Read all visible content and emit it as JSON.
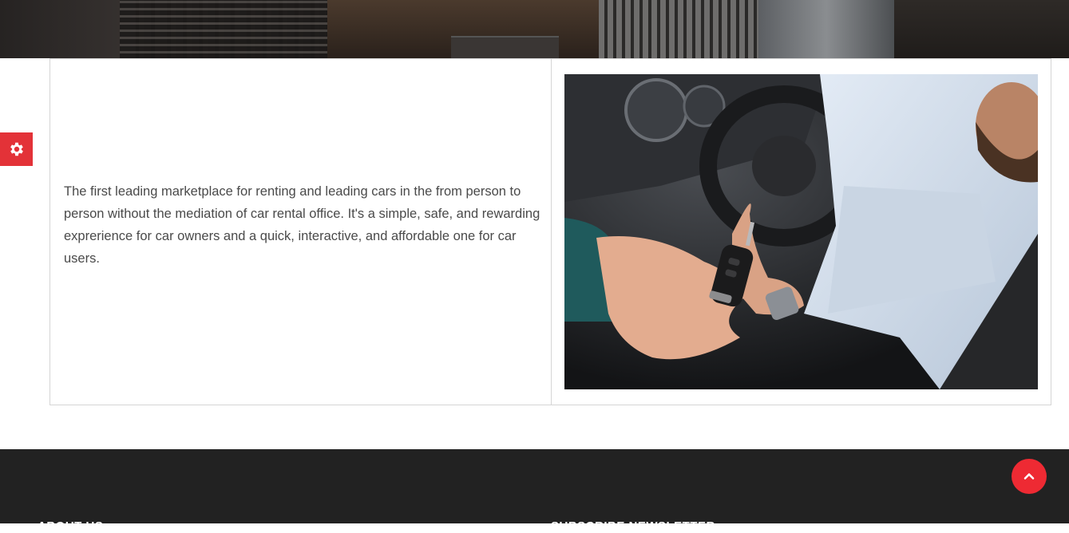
{
  "intro": {
    "text": "The first leading marketplace for renting and leading cars in the from person to person without the mediation of car rental office. It's a simple, safe, and rewarding exprerience for car owners and a quick, interactive, and affordable one for car users."
  },
  "image": {
    "alt": "Car key handover"
  },
  "footer": {
    "about_heading": "ABOUT US",
    "newsletter_heading": "SUBSCRIBE NEWSLETTER"
  },
  "icons": {
    "settings": "gear-icon",
    "scroll_top": "chevron-up-icon"
  },
  "colors": {
    "accent": "#e33238",
    "footer_bg": "#222222",
    "text": "#4a4a4a"
  }
}
